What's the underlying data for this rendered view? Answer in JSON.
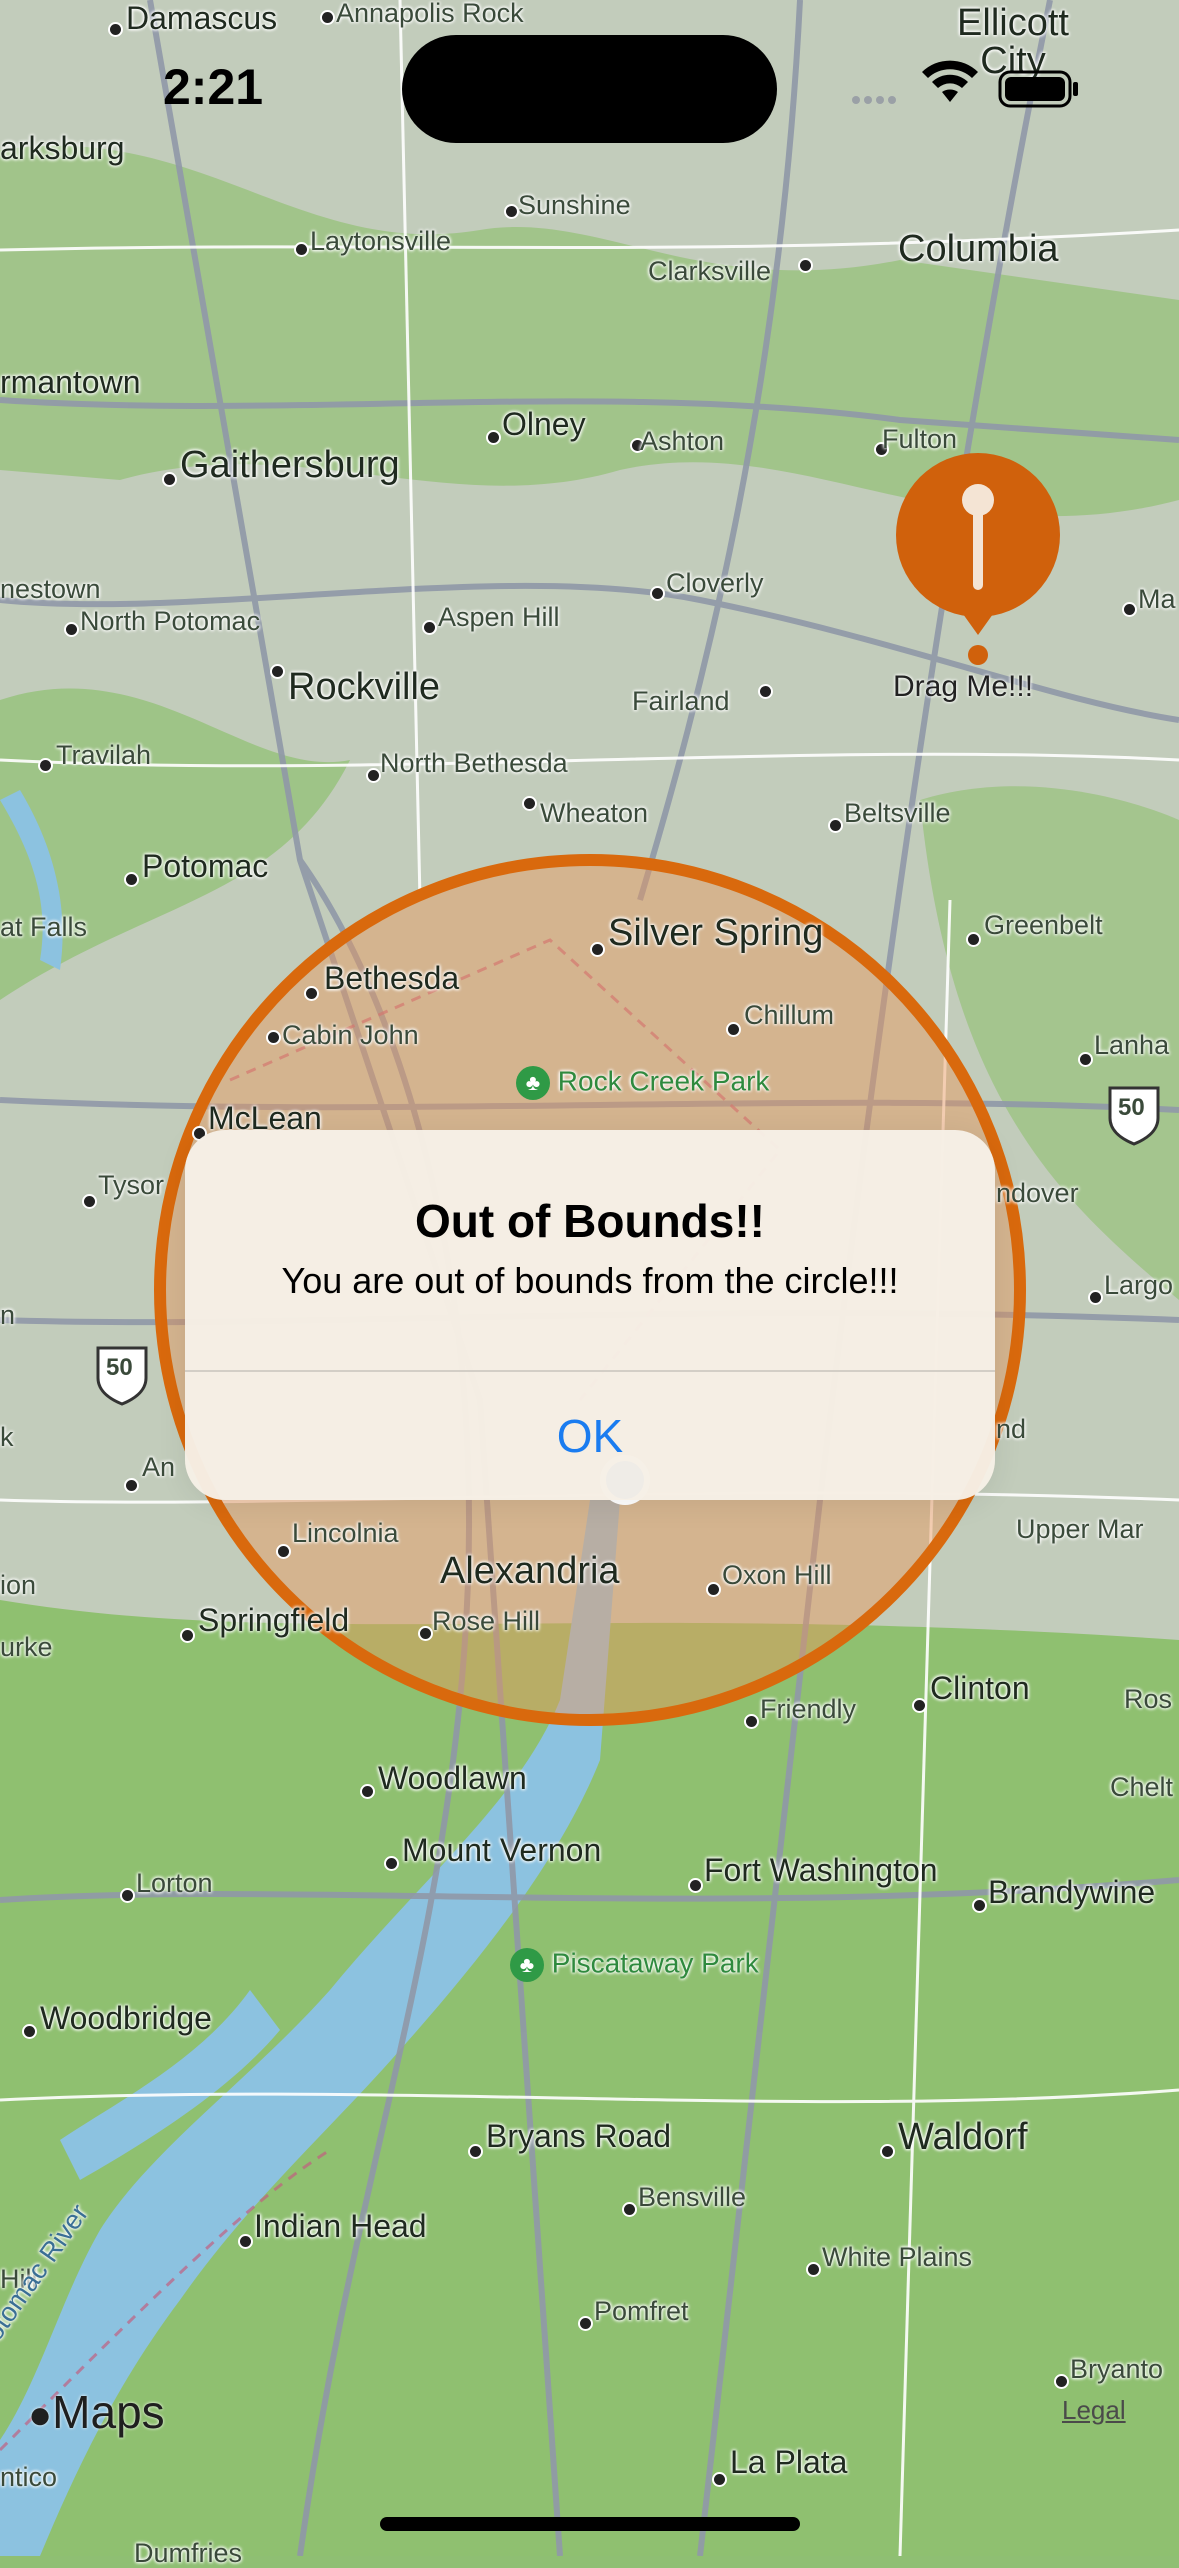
{
  "status_bar": {
    "time": "2:21"
  },
  "map": {
    "places": [
      {
        "name": "Damascus",
        "size": "med"
      },
      {
        "name": "Annapolis Rock",
        "size": "small"
      },
      {
        "name": "Ellicott City",
        "size": "big"
      },
      {
        "name": "arksburg",
        "size": "med"
      },
      {
        "name": "Sunshine",
        "size": "small"
      },
      {
        "name": "Laytonsville",
        "size": "small"
      },
      {
        "name": "Clarksville",
        "size": "small"
      },
      {
        "name": "Columbia",
        "size": "big"
      },
      {
        "name": "rmantown",
        "size": "med"
      },
      {
        "name": "Olney",
        "size": "med"
      },
      {
        "name": "Ashton",
        "size": "small"
      },
      {
        "name": "Fulton",
        "size": "small"
      },
      {
        "name": "Gaithersburg",
        "size": "big"
      },
      {
        "name": "nestown",
        "size": "small"
      },
      {
        "name": "North Potomac",
        "size": "small"
      },
      {
        "name": "Aspen Hill",
        "size": "small"
      },
      {
        "name": "Cloverly",
        "size": "small"
      },
      {
        "name": "Ma",
        "size": "small"
      },
      {
        "name": "Rockville",
        "size": "big"
      },
      {
        "name": "Fairland",
        "size": "small"
      },
      {
        "name": "Travilah",
        "size": "small"
      },
      {
        "name": "North Bethesda",
        "size": "small"
      },
      {
        "name": "Wheaton",
        "size": "small"
      },
      {
        "name": "Beltsville",
        "size": "small"
      },
      {
        "name": "Potomac",
        "size": "med"
      },
      {
        "name": "at Falls",
        "size": "small"
      },
      {
        "name": "Silver Spring",
        "size": "big"
      },
      {
        "name": "Greenbelt",
        "size": "small"
      },
      {
        "name": "Bethesda",
        "size": "med"
      },
      {
        "name": "Chillum",
        "size": "small"
      },
      {
        "name": "Cabin John",
        "size": "small"
      },
      {
        "name": "Lanha",
        "size": "small"
      },
      {
        "name": "McLean",
        "size": "med"
      },
      {
        "name": "Tysor",
        "size": "small"
      },
      {
        "name": "ndover",
        "size": "small"
      },
      {
        "name": "Largo",
        "size": "small"
      },
      {
        "name": "n",
        "size": "small"
      },
      {
        "name": "k",
        "size": "small"
      },
      {
        "name": "An",
        "size": "small"
      },
      {
        "name": "nd",
        "size": "small"
      },
      {
        "name": "Upper Mar",
        "size": "small"
      },
      {
        "name": "Lincolnia",
        "size": "small"
      },
      {
        "name": "Alexandria",
        "size": "big"
      },
      {
        "name": "Oxon Hill",
        "size": "small"
      },
      {
        "name": "ion",
        "size": "small"
      },
      {
        "name": "urke",
        "size": "small"
      },
      {
        "name": "Springfield",
        "size": "med"
      },
      {
        "name": "Rose Hill",
        "size": "small"
      },
      {
        "name": "Friendly",
        "size": "small"
      },
      {
        "name": "Clinton",
        "size": "med"
      },
      {
        "name": "Ros",
        "size": "small"
      },
      {
        "name": "Woodlawn",
        "size": "med"
      },
      {
        "name": "Chelt",
        "size": "small"
      },
      {
        "name": "Mount Vernon",
        "size": "med"
      },
      {
        "name": "Lorton",
        "size": "small"
      },
      {
        "name": "Fort Washington",
        "size": "med"
      },
      {
        "name": "Brandywine",
        "size": "med"
      },
      {
        "name": "Woodbridge",
        "size": "med"
      },
      {
        "name": "Bryans Road",
        "size": "med"
      },
      {
        "name": "Waldorf",
        "size": "big"
      },
      {
        "name": "Bensville",
        "size": "small"
      },
      {
        "name": "Indian Head",
        "size": "med"
      },
      {
        "name": "White Plains",
        "size": "small"
      },
      {
        "name": "Hill",
        "size": "small"
      },
      {
        "name": "Pomfret",
        "size": "small"
      },
      {
        "name": "Bryanto",
        "size": "small"
      },
      {
        "name": "La Plata",
        "size": "med"
      },
      {
        "name": "ntico",
        "size": "small"
      },
      {
        "name": "Dumfries",
        "size": "small"
      }
    ],
    "parks": [
      "Rock Creek Park",
      "Piscataway Park"
    ],
    "river": "otomac River",
    "route_shields": [
      "50",
      "50"
    ],
    "circle_color": "#d9690d",
    "circle_fill": "rgba(230,150,90,0.45)"
  },
  "pin": {
    "label": "Drag Me!!!",
    "color": "#d0610c"
  },
  "alert": {
    "title": "Out of Bounds!!",
    "message": "You are out of bounds from the circle!!!",
    "ok_label": "OK",
    "button_color": "#1a7cf0"
  },
  "footer": {
    "maps_label": "Maps",
    "legal_label": "Legal"
  }
}
